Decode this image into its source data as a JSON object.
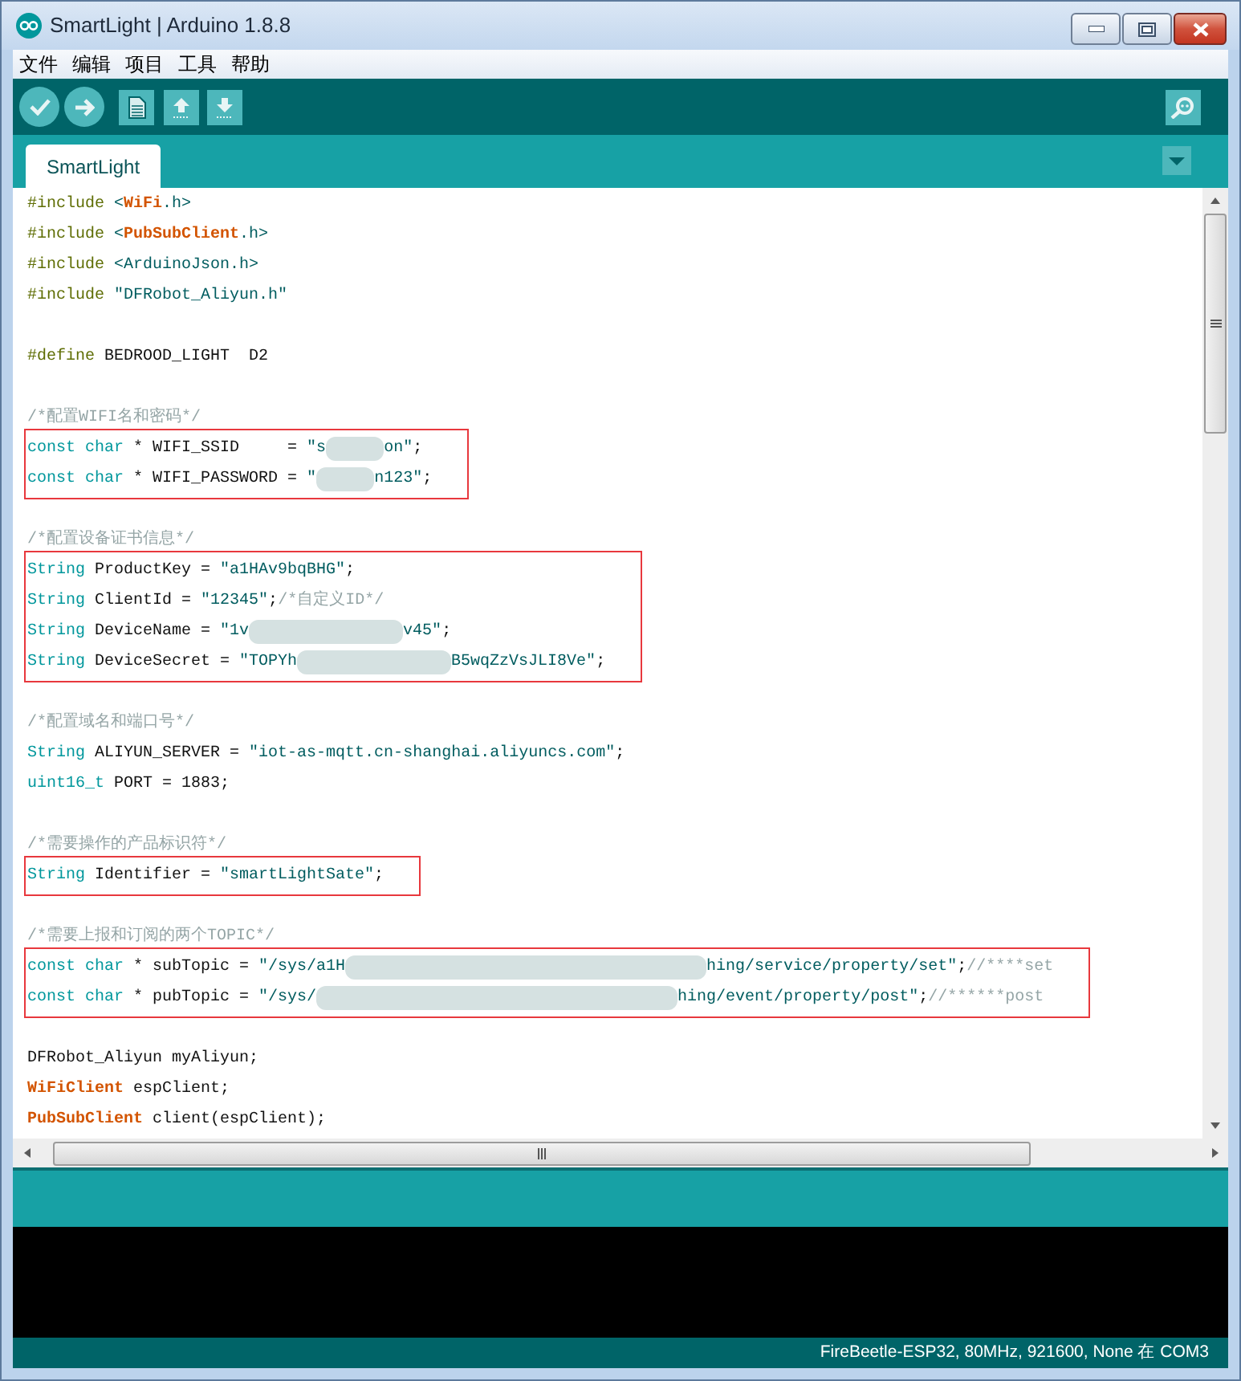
{
  "window": {
    "title": "SmartLight | Arduino 1.8.8"
  },
  "menu": [
    "文件",
    "编辑",
    "项目",
    "工具",
    "帮助"
  ],
  "tabs": [
    {
      "label": "SmartLight",
      "selected": true
    }
  ],
  "editor": {
    "blocks": [
      {
        "annotated": false,
        "lines": [
          {
            "kind": "code",
            "tokens": [
              {
                "kind": "directive",
                "text": "#include "
              },
              {
                "kind": "string",
                "text": "<"
              },
              {
                "kind": "library",
                "text": "WiFi"
              },
              {
                "kind": "string",
                "text": ".h>"
              }
            ]
          },
          {
            "kind": "code",
            "tokens": [
              {
                "kind": "directive",
                "text": "#include "
              },
              {
                "kind": "string",
                "text": "<"
              },
              {
                "kind": "library",
                "text": "PubSubClient"
              },
              {
                "kind": "string",
                "text": ".h>"
              }
            ]
          },
          {
            "kind": "code",
            "tokens": [
              {
                "kind": "directive",
                "text": "#include "
              },
              {
                "kind": "string",
                "text": "<ArduinoJson.h>"
              }
            ]
          },
          {
            "kind": "code",
            "tokens": [
              {
                "kind": "directive",
                "text": "#include "
              },
              {
                "kind": "string",
                "text": "\"DFRobot_Aliyun.h\""
              }
            ]
          },
          {
            "kind": "blank"
          },
          {
            "kind": "code",
            "tokens": [
              {
                "kind": "directive",
                "text": "#define "
              },
              {
                "kind": "plain",
                "text": "BEDROOD_LIGHT  D2"
              }
            ]
          },
          {
            "kind": "blank"
          },
          {
            "kind": "code",
            "tokens": [
              {
                "kind": "comment",
                "text": "/*配置WIFI名和密码*/"
              }
            ]
          }
        ]
      },
      {
        "annotated": true,
        "lines": [
          {
            "kind": "code",
            "tokens": [
              {
                "kind": "keyword",
                "text": "const char"
              },
              {
                "kind": "plain",
                "text": " * WIFI_SSID     = "
              },
              {
                "kind": "string",
                "text": "\"s"
              },
              {
                "kind": "smudge"
              },
              {
                "kind": "string",
                "text": "on\""
              },
              {
                "kind": "plain",
                "text": ";"
              }
            ]
          },
          {
            "kind": "code",
            "tokens": [
              {
                "kind": "keyword",
                "text": "const char"
              },
              {
                "kind": "plain",
                "text": " * WIFI_PASSWORD = "
              },
              {
                "kind": "string",
                "text": "\""
              },
              {
                "kind": "smudge"
              },
              {
                "kind": "string",
                "text": "n123\""
              },
              {
                "kind": "plain",
                "text": ";"
              }
            ]
          }
        ]
      },
      {
        "annotated": false,
        "lines": [
          {
            "kind": "blank"
          },
          {
            "kind": "code",
            "tokens": [
              {
                "kind": "comment",
                "text": "/*配置设备证书信息*/"
              }
            ]
          }
        ]
      },
      {
        "annotated": true,
        "lines": [
          {
            "kind": "code",
            "tokens": [
              {
                "kind": "keyword",
                "text": "String"
              },
              {
                "kind": "plain",
                "text": " ProductKey = "
              },
              {
                "kind": "string",
                "text": "\"a1HAv9bqBHG\""
              },
              {
                "kind": "plain",
                "text": ";"
              }
            ]
          },
          {
            "kind": "code",
            "tokens": [
              {
                "kind": "keyword",
                "text": "String"
              },
              {
                "kind": "plain",
                "text": " ClientId = "
              },
              {
                "kind": "string",
                "text": "\"12345\""
              },
              {
                "kind": "plain",
                "text": ";"
              },
              {
                "kind": "comment",
                "text": "/*自定义ID*/"
              }
            ]
          },
          {
            "kind": "code",
            "tokens": [
              {
                "kind": "keyword",
                "text": "String"
              },
              {
                "kind": "plain",
                "text": " DeviceName = "
              },
              {
                "kind": "string",
                "text": "\"1v"
              },
              {
                "kind": "blur"
              },
              {
                "kind": "string",
                "text": "v45\""
              },
              {
                "kind": "plain",
                "text": ";"
              }
            ]
          },
          {
            "kind": "code",
            "tokens": [
              {
                "kind": "keyword",
                "text": "String"
              },
              {
                "kind": "plain",
                "text": " DeviceSecret = "
              },
              {
                "kind": "string",
                "text": "\"TOPYh"
              },
              {
                "kind": "blur"
              },
              {
                "kind": "string",
                "text": "B5wqZzVsJLI8Ve\""
              },
              {
                "kind": "plain",
                "text": ";"
              }
            ]
          }
        ]
      },
      {
        "annotated": false,
        "lines": [
          {
            "kind": "blank"
          },
          {
            "kind": "code",
            "tokens": [
              {
                "kind": "comment",
                "text": "/*配置域名和端口号*/"
              }
            ]
          },
          {
            "kind": "code",
            "tokens": [
              {
                "kind": "keyword",
                "text": "String"
              },
              {
                "kind": "plain",
                "text": " ALIYUN_SERVER = "
              },
              {
                "kind": "string",
                "text": "\"iot-as-mqtt.cn-shanghai.aliyuncs.com\""
              },
              {
                "kind": "plain",
                "text": ";"
              }
            ]
          },
          {
            "kind": "code",
            "tokens": [
              {
                "kind": "keyword",
                "text": "uint16_t"
              },
              {
                "kind": "plain",
                "text": " PORT = 1883;"
              }
            ]
          },
          {
            "kind": "blank"
          },
          {
            "kind": "code",
            "tokens": [
              {
                "kind": "comment",
                "text": "/*需要操作的产品标识符*/"
              }
            ]
          }
        ]
      },
      {
        "annotated": true,
        "lines": [
          {
            "kind": "code",
            "tokens": [
              {
                "kind": "keyword",
                "text": "String"
              },
              {
                "kind": "plain",
                "text": " Identifier = "
              },
              {
                "kind": "string",
                "text": "\"smartLightSate\""
              },
              {
                "kind": "plain",
                "text": ";"
              }
            ]
          }
        ]
      },
      {
        "annotated": false,
        "lines": [
          {
            "kind": "blank"
          },
          {
            "kind": "code",
            "tokens": [
              {
                "kind": "comment",
                "text": "/*需要上报和订阅的两个TOPIC*/"
              }
            ]
          }
        ]
      },
      {
        "annotated": true,
        "lines": [
          {
            "kind": "code",
            "tokens": [
              {
                "kind": "keyword",
                "text": "const char"
              },
              {
                "kind": "plain",
                "text": " * subTopic = "
              },
              {
                "kind": "string",
                "text": "\"/sys/a1H"
              },
              {
                "kind": "smear"
              },
              {
                "kind": "string",
                "text": "hing/service/property/set\""
              },
              {
                "kind": "plain",
                "text": ";"
              },
              {
                "kind": "comment",
                "text": "//****set"
              }
            ]
          },
          {
            "kind": "code",
            "tokens": [
              {
                "kind": "keyword",
                "text": "const char"
              },
              {
                "kind": "plain",
                "text": " * pubTopic = "
              },
              {
                "kind": "string",
                "text": "\"/sys/"
              },
              {
                "kind": "smear"
              },
              {
                "kind": "string",
                "text": "hing/event/property/post\""
              },
              {
                "kind": "plain",
                "text": ";"
              },
              {
                "kind": "comment",
                "text": "//******post"
              }
            ]
          }
        ]
      },
      {
        "annotated": false,
        "lines": [
          {
            "kind": "blank"
          },
          {
            "kind": "code",
            "tokens": [
              {
                "kind": "plain",
                "text": "DFRobot_Aliyun myAliyun;"
              }
            ]
          },
          {
            "kind": "code",
            "tokens": [
              {
                "kind": "library",
                "text": "WiFiClient"
              },
              {
                "kind": "plain",
                "text": " espClient;"
              }
            ]
          },
          {
            "kind": "code",
            "tokens": [
              {
                "kind": "library",
                "text": "PubSubClient"
              },
              {
                "kind": "plain",
                "text": " client(espClient);"
              }
            ]
          }
        ]
      }
    ]
  },
  "status_bar": {
    "board": "FireBeetle-ESP32, 80MHz, 921600, None 在 COM3"
  }
}
